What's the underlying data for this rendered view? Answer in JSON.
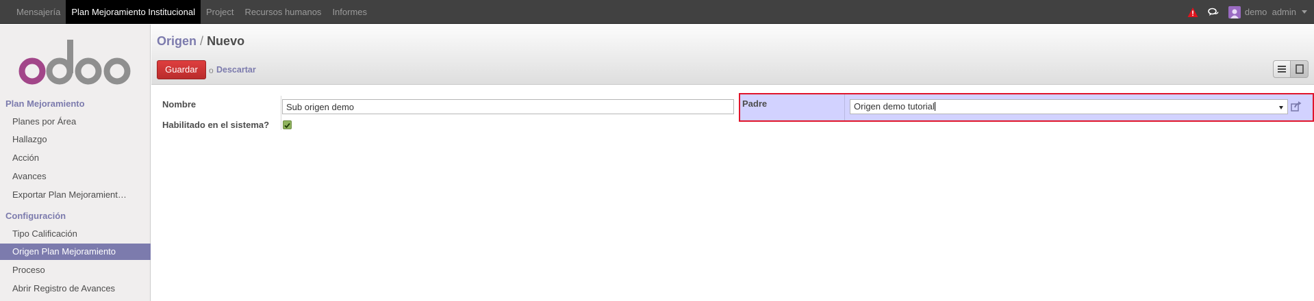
{
  "topmenu": {
    "items": [
      {
        "label": "Mensajería",
        "active": false
      },
      {
        "label": "Plan Mejoramiento Institucional",
        "active": true
      },
      {
        "label": "Project",
        "active": false
      },
      {
        "label": "Recursos humanos",
        "active": false
      },
      {
        "label": "Informes",
        "active": false
      }
    ],
    "user": "demo  admin",
    "icons": [
      "alert-icon",
      "chat-icon",
      "avatar-icon",
      "caret-down-icon"
    ]
  },
  "sidebar": {
    "logo_text": "odoo",
    "sections": [
      {
        "title": "Plan Mejoramiento",
        "items": [
          {
            "label": "Planes por Área",
            "active": false
          },
          {
            "label": "Hallazgo",
            "active": false
          },
          {
            "label": "Acción",
            "active": false
          },
          {
            "label": "Avances",
            "active": false
          },
          {
            "label": "Exportar Plan Mejoramient…",
            "active": false
          }
        ]
      },
      {
        "title": "Configuración",
        "items": [
          {
            "label": "Tipo Calificación",
            "active": false
          },
          {
            "label": "Origen Plan Mejoramiento",
            "active": true
          },
          {
            "label": "Proceso",
            "active": false
          },
          {
            "label": "Abrir Registro de Avances",
            "active": false
          }
        ]
      }
    ]
  },
  "header": {
    "breadcrumb_parent": "Origen",
    "breadcrumb_sep": "/",
    "breadcrumb_current": "Nuevo",
    "save_label": "Guardar",
    "or_text": "o",
    "discard_label": "Descartar"
  },
  "form": {
    "nombre_label": "Nombre",
    "nombre_value": "Sub origen demo",
    "habilitado_label": "Habilitado en el sistema?",
    "habilitado_checked": true,
    "padre_label": "Padre",
    "padre_value": "Origen demo tutorial"
  },
  "colors": {
    "accent": "#7c7bad",
    "save_button": "#c52f2f",
    "highlight_border": "#e0142a",
    "highlight_bg": "#d2d2ff",
    "topbar": "#414141"
  }
}
